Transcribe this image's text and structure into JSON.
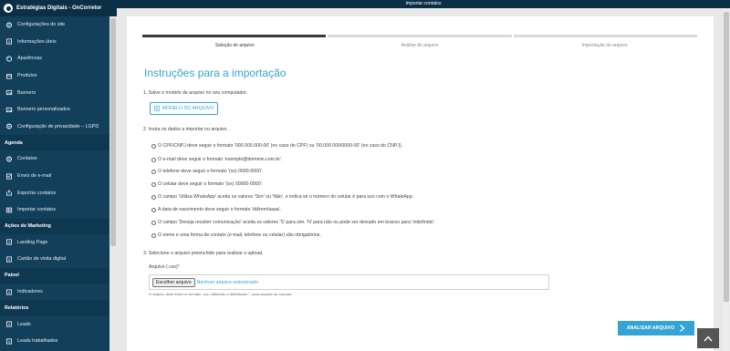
{
  "brand": {
    "title": "Estratégias Digitais - OnCorretor"
  },
  "topbar": {
    "title": "Importar contatos"
  },
  "sidebar": {
    "items": [
      {
        "label": "Configurações do site",
        "icon": "gear-icon"
      },
      {
        "label": "Informações úteis",
        "icon": "info-icon"
      },
      {
        "label": "Aparências",
        "icon": "palette-icon"
      },
      {
        "label": "Produtos",
        "icon": "box-icon"
      },
      {
        "label": "Banners",
        "icon": "image-icon"
      },
      {
        "label": "Banners personalizados",
        "icon": "image-icon"
      },
      {
        "label": "Configuração de privacidade – LGPD",
        "icon": "shield-icon"
      }
    ],
    "section_agenda": "Agenda",
    "agenda_items": [
      {
        "label": "Contatos",
        "icon": "contacts-icon"
      },
      {
        "label": "Envio de e-mail",
        "icon": "mail-icon"
      },
      {
        "label": "Exportar contatos",
        "icon": "export-icon"
      },
      {
        "label": "Importar contatos",
        "icon": "table-icon"
      }
    ],
    "section_marketing": "Ações de Marketing",
    "marketing_items": [
      {
        "label": "Landing Page",
        "icon": "monitor-icon"
      },
      {
        "label": "Cartão de visita digital",
        "icon": "card-icon"
      }
    ],
    "section_painel": "Painel",
    "painel_items": [
      {
        "label": "Indicadores",
        "icon": "dashboard-icon"
      }
    ],
    "section_relatorios": "Relatórios",
    "relatorios_items": [
      {
        "label": "Leads",
        "icon": "list-icon"
      },
      {
        "label": "Leads trabalhados",
        "icon": "list-icon"
      }
    ]
  },
  "steps": [
    {
      "label": "Seleção do arquivo",
      "active": true
    },
    {
      "label": "Análise do arquivo",
      "active": false
    },
    {
      "label": "Importação do arquivo",
      "active": false
    }
  ],
  "main": {
    "title": "Instruções para a importação",
    "step1": "1. Salve o modelo de arquivo no seu computador.",
    "download_button": "MODELO DO ARQUIVO",
    "step2": "2. Insira os dados a importar no arquivo.",
    "rules": [
      "O CPF/CNPJ deve seguir o formato '000.000.000-00' (no caso do CPF) ou '00.000.000/0000-00' (no caso do CNPJ).",
      "O e-mail deve seguir o formato 'exemplo@dominio.com.br'.",
      "O telefone deve seguir o formato '(xx) 0000-0000'.",
      "O celular deve seguir o formato '(xx) 00000-0000'.",
      "O campo 'Utiliza WhatsApp' aceita os valores 'Sim' ou 'Não', e indica se o número do celular é para uso com o WhatsApp.",
      "A data de nascimento deve seguir o formato 'dd/mm/aaaa'.",
      "O campo 'Deseja receber comunicação' aceita os valores 'S' para sim, 'N' para não ou pode ser deixado em branco para 'indefinido'.",
      "O nome e uma forma de contato (e-mail, telefone ou celular) são obrigatórios."
    ],
    "step3": "3. Selecione o arquivo preenchido para realizar o upload.",
    "file_label": "Arquivo (.csv)*",
    "file_button": "Escolher arquivo",
    "file_status": "Nenhum arquivo selecionado",
    "file_hint": "O arquivo deve estar no formato .csv, utilizando o delimitador ';' para separar as colunas.",
    "analyze_button": "ANALISAR ARQUIVO"
  },
  "colors": {
    "sidebar": "#123f5a",
    "accent": "#35a3d3",
    "topbar": "#0b2f45"
  }
}
